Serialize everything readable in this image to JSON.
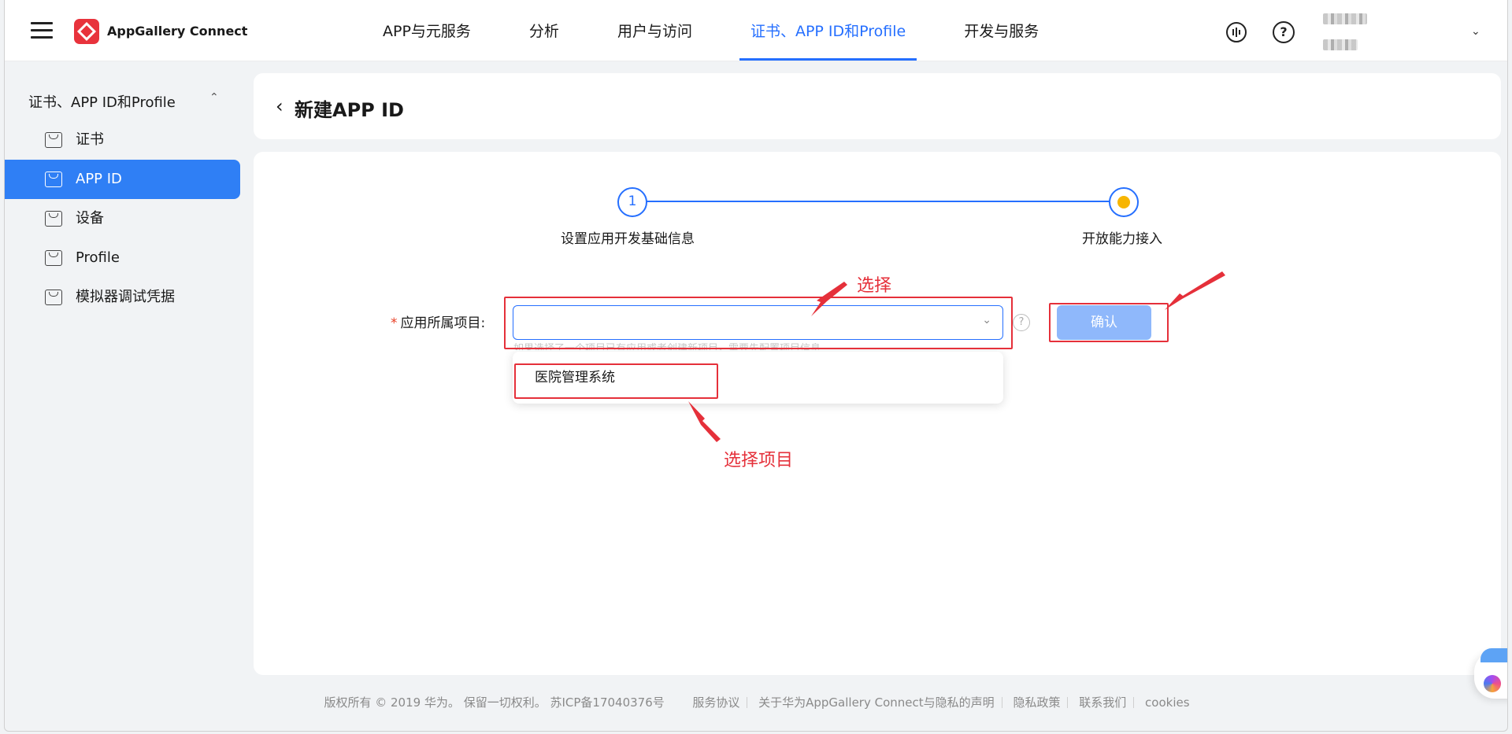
{
  "header": {
    "brand": "AppGallery Connect",
    "nav": [
      {
        "label": "APP与元服务",
        "active": false
      },
      {
        "label": "分析",
        "active": false
      },
      {
        "label": "用户与访问",
        "active": false
      },
      {
        "label": "证书、APP ID和Profile",
        "active": true
      },
      {
        "label": "开发与服务",
        "active": false
      }
    ],
    "feedback_icon": "feedback-icon",
    "help_icon": "?"
  },
  "sidebar": {
    "group_label": "证书、APP ID和Profile",
    "items": [
      {
        "label": "证书",
        "active": false
      },
      {
        "label": "APP ID",
        "active": true
      },
      {
        "label": "设备",
        "active": false
      },
      {
        "label": "Profile",
        "active": false
      },
      {
        "label": "模拟器调试凭据",
        "active": false
      }
    ]
  },
  "page": {
    "back_icon": "‹",
    "title": "新建APP ID"
  },
  "steps": [
    {
      "number": "1",
      "label": "设置应用开发基础信息"
    },
    {
      "label": "开放能力接入"
    }
  ],
  "form": {
    "required_mark": "*",
    "project_label": "应用所属项目:",
    "selected_value": "",
    "help": "?",
    "confirm_label": "确认",
    "hint": "如果选择了一个项目已有应用或者创建新项目，需要先配置项目信息",
    "options": [
      "医院管理系统"
    ]
  },
  "annotations": {
    "select_note": "选择",
    "option_note": "选择项目"
  },
  "footer": {
    "copyright": "版权所有 © 2019 华为。 保留一切权利。 苏ICP备17040376号",
    "links": [
      "服务协议",
      "关于华为AppGallery Connect与隐私的声明",
      "隐私政策",
      "联系我们",
      "cookies"
    ]
  },
  "colors": {
    "accent": "#256fff",
    "annotation": "#e5303a",
    "step_dot": "#f7b500",
    "sidebar_active": "#2f7ff5"
  }
}
